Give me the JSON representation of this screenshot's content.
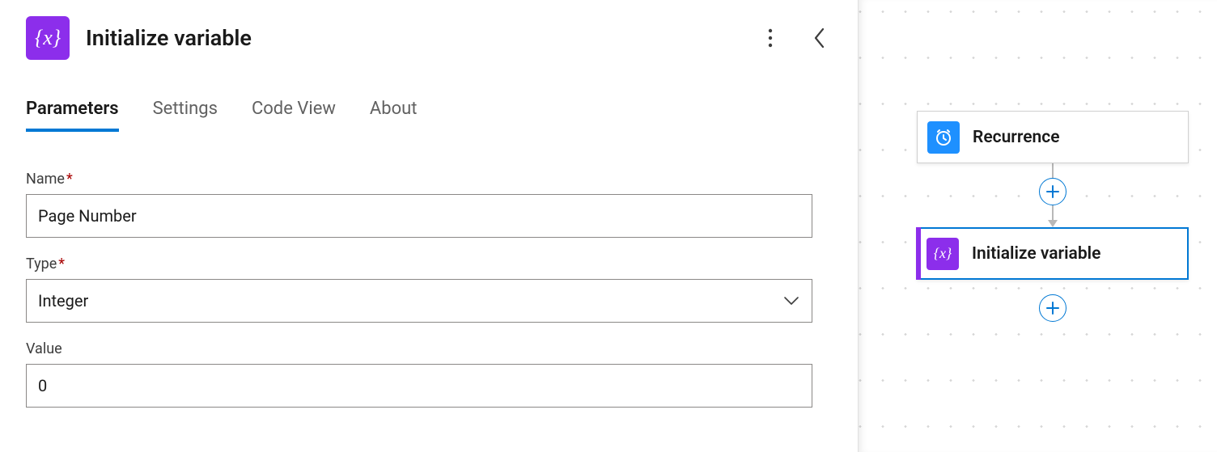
{
  "panel": {
    "title": "Initialize variable"
  },
  "tabs": {
    "parameters": "Parameters",
    "settings": "Settings",
    "codeview": "Code View",
    "about": "About"
  },
  "fields": {
    "name_label": "Name",
    "name_value": "Page Number",
    "type_label": "Type",
    "type_value": "Integer",
    "value_label": "Value",
    "value_value": "0"
  },
  "flow": {
    "trigger_title": "Recurrence",
    "action_title": "Initialize variable"
  }
}
